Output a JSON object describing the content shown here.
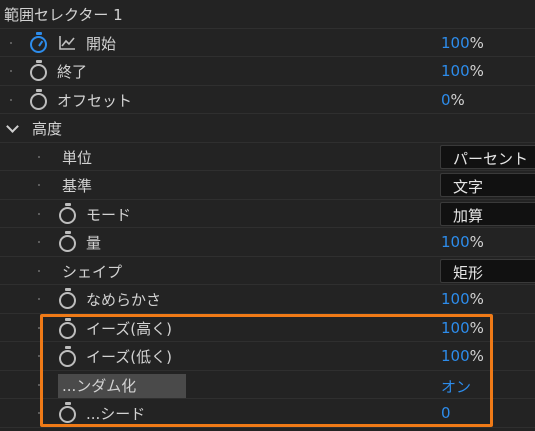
{
  "section_title": "範囲セレクター 1",
  "properties": [
    {
      "label": "開始",
      "value": "100",
      "unit": "%"
    },
    {
      "label": "終了",
      "value": "100",
      "unit": "%"
    },
    {
      "label": "オフセット",
      "value": "0",
      "unit": "%"
    }
  ],
  "advanced": {
    "title": "高度",
    "units": {
      "label": "単位",
      "value": "パーセント"
    },
    "based_on": {
      "label": "基準",
      "value": "文字"
    },
    "mode": {
      "label": "モード",
      "value": "加算"
    },
    "amount": {
      "label": "量",
      "value": "100",
      "unit": "%"
    },
    "shape": {
      "label": "シェイプ",
      "value": "矩形"
    },
    "smoothness": {
      "label": "なめらかさ",
      "value": "100",
      "unit": "%"
    },
    "ease_high": {
      "label": "イーズ(高く)",
      "value": "100",
      "unit": "%"
    },
    "ease_low": {
      "label": "イーズ(低く)",
      "value": "100",
      "unit": "%"
    },
    "randomize": {
      "label": "...ンダム化",
      "value": "オン"
    },
    "seed": {
      "label": "...シード",
      "value": "0"
    }
  },
  "icons": {
    "stopwatch": "stopwatch-icon",
    "graph": "graph-icon",
    "chevron": "chevron-down-icon"
  },
  "colors": {
    "background": "#232323",
    "value_blue": "#2d8ceb",
    "highlight_orange": "#ef7a17"
  }
}
